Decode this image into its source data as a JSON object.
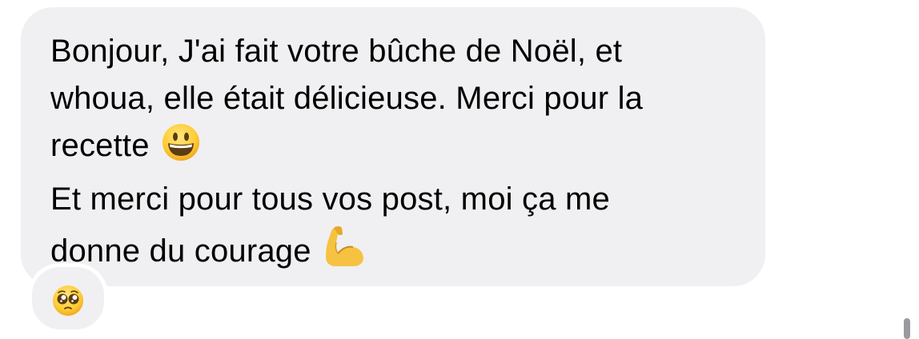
{
  "message": {
    "lines": [
      "Bonjour, J'ai fait votre bûche de Noël, et",
      "whoua, elle était délicieuse. Merci pour la",
      "recette",
      "Et merci pour tous vos post, moi ça me",
      "donne du courage"
    ],
    "emojis": {
      "line3": "grinning-face",
      "line5": "flexed-biceps"
    }
  },
  "reaction": {
    "emoji": "pleading-face"
  },
  "colors": {
    "bubble": "#f0f0f2",
    "text": "#000000",
    "background": "#ffffff",
    "scrollbar": "#9a9a9e"
  }
}
